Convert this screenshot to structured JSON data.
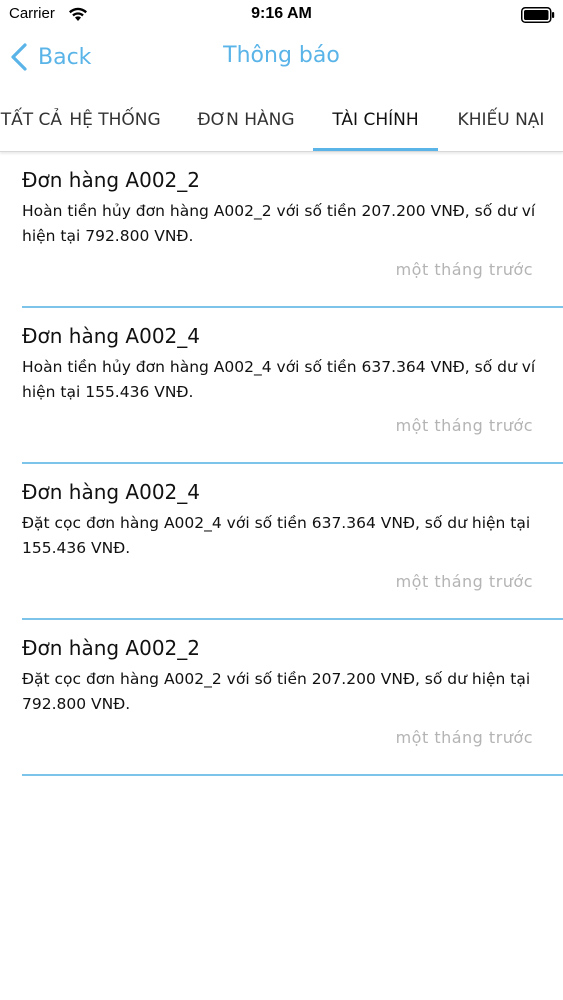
{
  "status_bar": {
    "carrier": "Carrier",
    "time": "9:16 AM"
  },
  "nav": {
    "back_label": "Back",
    "title": "Thông báo"
  },
  "tabs": [
    {
      "label": "TẤT CẢ",
      "active": false
    },
    {
      "label": "HỆ THỐNG",
      "active": false
    },
    {
      "label": "ĐƠN HÀNG",
      "active": false
    },
    {
      "label": "TÀI CHÍNH",
      "active": true
    },
    {
      "label": "KHIẾU NẠI",
      "active": false
    }
  ],
  "notifications": [
    {
      "title": "Đơn hàng A002_2",
      "body": "Hoàn tiền hủy đơn hàng A002_2 với số tiền 207.200 VNĐ, số dư ví hiện tại 792.800 VNĐ.",
      "time": "một tháng trước"
    },
    {
      "title": "Đơn hàng A002_4",
      "body": "Hoàn tiền hủy đơn hàng A002_4 với số tiền 637.364 VNĐ, số dư ví hiện tại 155.436 VNĐ.",
      "time": "một tháng trước"
    },
    {
      "title": "Đơn hàng A002_4",
      "body": "Đặt cọc đơn hàng A002_4 với số tiền 637.364 VNĐ, số dư hiện tại 155.436 VNĐ.",
      "time": "một tháng trước"
    },
    {
      "title": "Đơn hàng A002_2",
      "body": "Đặt cọc đơn hàng A002_2 với số tiền 207.200 VNĐ, số dư hiện tại 792.800 VNĐ.",
      "time": "một tháng trước"
    }
  ],
  "colors": {
    "accent": "#5ab4e8",
    "divider": "#7cc4ea",
    "muted_text": "#b4b4b4"
  },
  "icons": {
    "back": "chevron-left-icon",
    "wifi": "wifi-icon",
    "battery": "battery-icon"
  }
}
